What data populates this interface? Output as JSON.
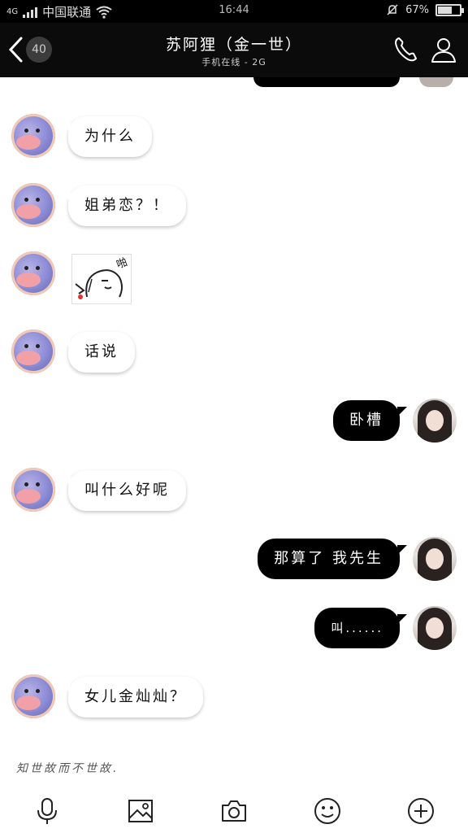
{
  "status_bar": {
    "network": "4G",
    "carrier": "中国联通",
    "time": "16:44",
    "battery": "67%",
    "battery_level": 0.67,
    "icons": [
      "signal-icon",
      "wifi-icon",
      "mute-bell-icon",
      "battery-icon"
    ]
  },
  "header": {
    "unread_count": "40",
    "title": "苏阿狸（金一世）",
    "subtitle": "手机在线 - 2G",
    "icons": [
      "back-icon",
      "phone-icon",
      "profile-icon"
    ]
  },
  "messages": [
    {
      "side": "in",
      "text": "为什么"
    },
    {
      "side": "in",
      "text": "姐弟恋？！"
    },
    {
      "side": "in",
      "type": "sticker",
      "text": "啪"
    },
    {
      "side": "in",
      "text": "话说"
    },
    {
      "side": "out",
      "text": "卧槽"
    },
    {
      "side": "in",
      "text": "叫什么好呢"
    },
    {
      "side": "out",
      "text": "那算了 我先生"
    },
    {
      "side": "out",
      "text": "叫......"
    },
    {
      "side": "in",
      "text": "女儿金灿灿？"
    }
  ],
  "footer_note": "知世故而不世故.",
  "toolbar": {
    "icons": [
      "microphone-icon",
      "image-icon",
      "camera-icon",
      "emoji-icon",
      "plus-icon"
    ]
  }
}
